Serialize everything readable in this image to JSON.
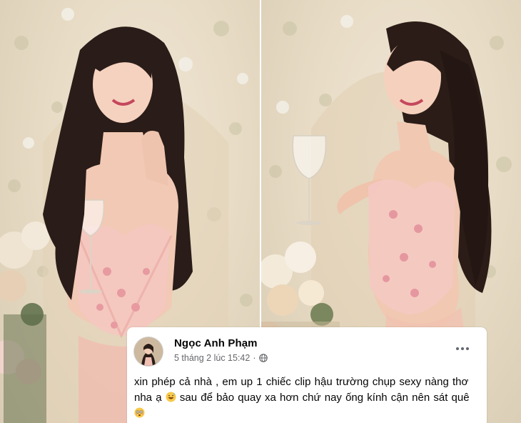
{
  "photos": [
    {
      "name": "left-photo"
    },
    {
      "name": "right-photo"
    }
  ],
  "post": {
    "author": "Ngọc Anh Phạm",
    "timestamp": "5 tháng 2 lúc 15:42",
    "separator": "·",
    "privacy_icon": "globe-icon",
    "more_icon": "more-options-icon",
    "text_part1": "xin phép cả nhà , em up 1 chiếc clip hậu trường chụp  sexy  nàng thơ nha ạ",
    "emoji1": "grinning-sweat-emoji",
    "text_part2": "sau để bảo quay xa hơn chứ nay ống kính cận nên sát quê",
    "emoji2": "flushed-face-emoji"
  }
}
